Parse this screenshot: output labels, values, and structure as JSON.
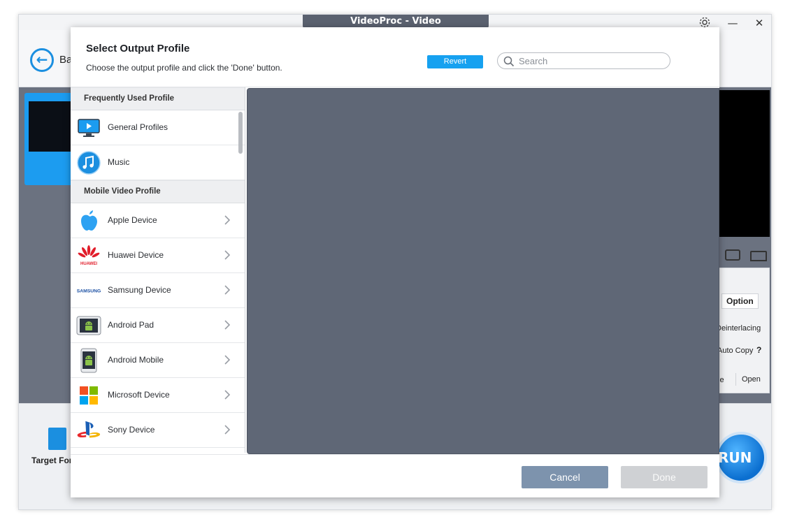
{
  "window": {
    "title": "VideoProc - Video",
    "minimize_glyph": "—",
    "close_glyph": "✕",
    "settings_icon": "gear-icon"
  },
  "app": {
    "back_label": "Ba",
    "right_panel": {
      "option_label": "Option",
      "deinterlacing_label": "Deinterlacing",
      "auto_copy_label": "Auto Copy",
      "help_glyph": "?",
      "browse_label": "se",
      "open_label": "Open"
    },
    "target_format_label": "Target For",
    "run_label": "RUN"
  },
  "dialog": {
    "title": "Select Output Profile",
    "subtitle": "Choose the output profile and click the 'Done' button.",
    "revert_label": "Revert",
    "search_placeholder": "Search",
    "search_value": "",
    "sections": {
      "frequent": {
        "header": "Frequently Used Profile",
        "items": [
          {
            "label": "General Profiles",
            "icon": "monitor-play-icon"
          },
          {
            "label": "Music",
            "icon": "music-note-icon"
          }
        ]
      },
      "mobile": {
        "header": "Mobile Video Profile",
        "items": [
          {
            "label": "Apple Device",
            "icon": "apple-logo-icon"
          },
          {
            "label": "Huawei Device",
            "icon": "huawei-logo-icon",
            "logo_text": "HUAWEI"
          },
          {
            "label": "Samsung Device",
            "icon": "samsung-logo-icon",
            "logo_text": "SAMSUNG"
          },
          {
            "label": "Android Pad",
            "icon": "android-tablet-icon"
          },
          {
            "label": "Android Mobile",
            "icon": "android-phone-icon"
          },
          {
            "label": "Microsoft Device",
            "icon": "microsoft-logo-icon"
          },
          {
            "label": "Sony Device",
            "icon": "playstation-logo-icon"
          }
        ]
      }
    },
    "cancel_label": "Cancel",
    "done_label": "Done"
  },
  "colors": {
    "accent_blue": "#16a1f0",
    "detail_panel": "#5f6776",
    "cancel_button": "#7d93ad",
    "done_button_disabled": "#cfd1d4"
  }
}
